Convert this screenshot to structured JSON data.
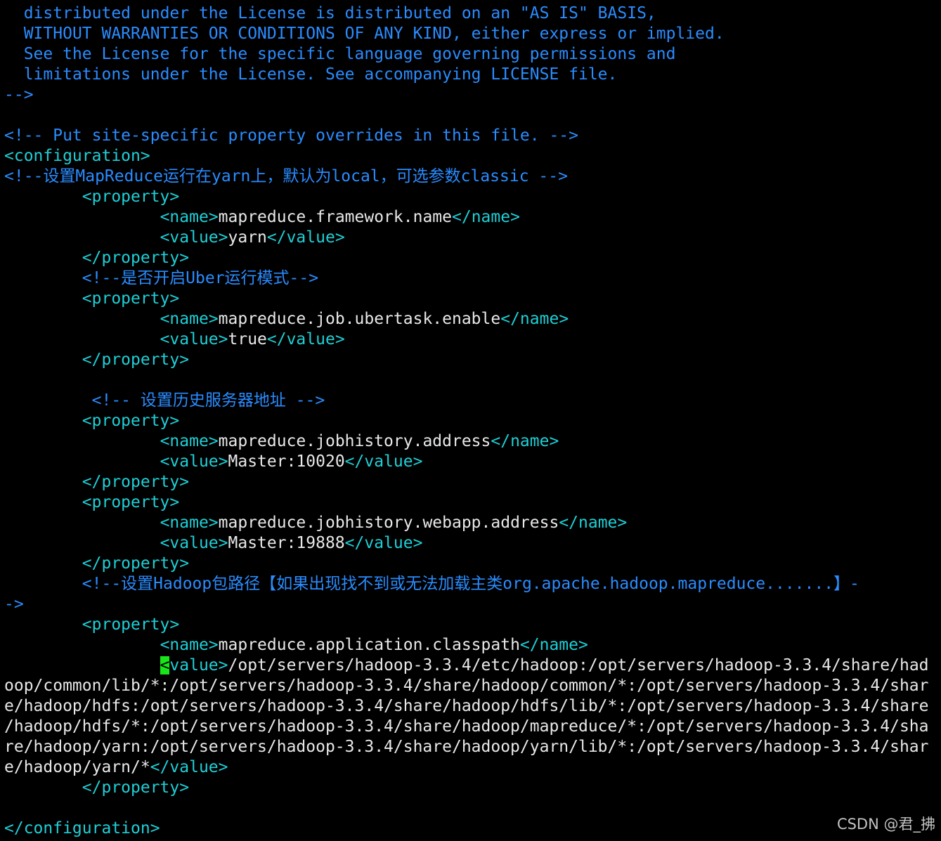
{
  "colors": {
    "background": "#000000",
    "comment": "#2a8cff",
    "tag": "#1ecfd6",
    "text": "#e8e8e8",
    "cursor": "#19e619"
  },
  "lines": [
    {
      "i": "  ",
      "s": [
        {
          "k": "c",
          "t": "distributed under the License is distributed on an \"AS IS\" BASIS,"
        }
      ]
    },
    {
      "i": "  ",
      "s": [
        {
          "k": "c",
          "t": "WITHOUT WARRANTIES OR CONDITIONS OF ANY KIND, either express or implied."
        }
      ]
    },
    {
      "i": "  ",
      "s": [
        {
          "k": "c",
          "t": "See the License for the specific language governing permissions and"
        }
      ]
    },
    {
      "i": "  ",
      "s": [
        {
          "k": "c",
          "t": "limitations under the License. See accompanying LICENSE file."
        }
      ]
    },
    {
      "i": "",
      "s": [
        {
          "k": "c",
          "t": "-->"
        }
      ]
    },
    {
      "i": "",
      "s": []
    },
    {
      "i": "",
      "s": [
        {
          "k": "c",
          "t": "<!-- Put site-specific property overrides in this file. -->"
        }
      ]
    },
    {
      "i": "",
      "s": [
        {
          "k": "t",
          "t": "<configuration>"
        }
      ]
    },
    {
      "i": "",
      "s": [
        {
          "k": "c",
          "t": "<!--设置MapReduce运行在yarn上，默认为local，可选参数classic -->"
        }
      ]
    },
    {
      "i": "        ",
      "s": [
        {
          "k": "t",
          "t": "<property>"
        }
      ]
    },
    {
      "i": "                ",
      "s": [
        {
          "k": "t",
          "t": "<name>"
        },
        {
          "k": "v",
          "t": "mapreduce.framework.name"
        },
        {
          "k": "t",
          "t": "</name>"
        }
      ]
    },
    {
      "i": "                ",
      "s": [
        {
          "k": "t",
          "t": "<value>"
        },
        {
          "k": "v",
          "t": "yarn"
        },
        {
          "k": "t",
          "t": "</value>"
        }
      ]
    },
    {
      "i": "        ",
      "s": [
        {
          "k": "t",
          "t": "</property>"
        }
      ]
    },
    {
      "i": "        ",
      "s": [
        {
          "k": "c",
          "t": "<!--是否开启Uber运行模式-->"
        }
      ]
    },
    {
      "i": "        ",
      "s": [
        {
          "k": "t",
          "t": "<property>"
        }
      ]
    },
    {
      "i": "                ",
      "s": [
        {
          "k": "t",
          "t": "<name>"
        },
        {
          "k": "v",
          "t": "mapreduce.job.ubertask.enable"
        },
        {
          "k": "t",
          "t": "</name>"
        }
      ]
    },
    {
      "i": "                ",
      "s": [
        {
          "k": "t",
          "t": "<value>"
        },
        {
          "k": "v",
          "t": "true"
        },
        {
          "k": "t",
          "t": "</value>"
        }
      ]
    },
    {
      "i": "        ",
      "s": [
        {
          "k": "t",
          "t": "</property>"
        }
      ]
    },
    {
      "i": "",
      "s": []
    },
    {
      "i": "         ",
      "s": [
        {
          "k": "c",
          "t": "<!-- 设置历史服务器地址 -->"
        }
      ]
    },
    {
      "i": "        ",
      "s": [
        {
          "k": "t",
          "t": "<property>"
        }
      ]
    },
    {
      "i": "                ",
      "s": [
        {
          "k": "t",
          "t": "<name>"
        },
        {
          "k": "v",
          "t": "mapreduce.jobhistory.address"
        },
        {
          "k": "t",
          "t": "</name>"
        }
      ]
    },
    {
      "i": "                ",
      "s": [
        {
          "k": "t",
          "t": "<value>"
        },
        {
          "k": "v",
          "t": "Master:10020"
        },
        {
          "k": "t",
          "t": "</value>"
        }
      ]
    },
    {
      "i": "        ",
      "s": [
        {
          "k": "t",
          "t": "</property>"
        }
      ]
    },
    {
      "i": "        ",
      "s": [
        {
          "k": "t",
          "t": "<property>"
        }
      ]
    },
    {
      "i": "                ",
      "s": [
        {
          "k": "t",
          "t": "<name>"
        },
        {
          "k": "v",
          "t": "mapreduce.jobhistory.webapp.address"
        },
        {
          "k": "t",
          "t": "</name>"
        }
      ]
    },
    {
      "i": "                ",
      "s": [
        {
          "k": "t",
          "t": "<value>"
        },
        {
          "k": "v",
          "t": "Master:19888"
        },
        {
          "k": "t",
          "t": "</value>"
        }
      ]
    },
    {
      "i": "        ",
      "s": [
        {
          "k": "t",
          "t": "</property>"
        }
      ]
    },
    {
      "i": "        ",
      "s": [
        {
          "k": "c",
          "t": "<!--设置Hadoop包路径【如果出现找不到或无法加载主类org.apache.hadoop.mapreduce.......】-"
        }
      ]
    },
    {
      "i": "",
      "s": [
        {
          "k": "c",
          "t": "->"
        }
      ]
    },
    {
      "i": "        ",
      "s": [
        {
          "k": "t",
          "t": "<property>"
        }
      ]
    },
    {
      "i": "                ",
      "s": [
        {
          "k": "t",
          "t": "<name>"
        },
        {
          "k": "v",
          "t": "mapreduce.application.classpath"
        },
        {
          "k": "t",
          "t": "</name>"
        }
      ]
    },
    {
      "i": "                ",
      "s": [
        {
          "k": "cursor",
          "t": "<"
        },
        {
          "k": "t",
          "t": "value>"
        },
        {
          "k": "v",
          "t": "/opt/servers/hadoop-3.3.4/etc/hadoop:/opt/servers/hadoop-3.3.4/share/had"
        }
      ]
    },
    {
      "i": "",
      "s": [
        {
          "k": "v",
          "t": "oop/common/lib/*:/opt/servers/hadoop-3.3.4/share/hadoop/common/*:/opt/servers/hadoop-3.3.4/shar"
        }
      ]
    },
    {
      "i": "",
      "s": [
        {
          "k": "v",
          "t": "e/hadoop/hdfs:/opt/servers/hadoop-3.3.4/share/hadoop/hdfs/lib/*:/opt/servers/hadoop-3.3.4/share"
        }
      ]
    },
    {
      "i": "",
      "s": [
        {
          "k": "v",
          "t": "/hadoop/hdfs/*:/opt/servers/hadoop-3.3.4/share/hadoop/mapreduce/*:/opt/servers/hadoop-3.3.4/sha"
        }
      ]
    },
    {
      "i": "",
      "s": [
        {
          "k": "v",
          "t": "re/hadoop/yarn:/opt/servers/hadoop-3.3.4/share/hadoop/yarn/lib/*:/opt/servers/hadoop-3.3.4/shar"
        }
      ]
    },
    {
      "i": "",
      "s": [
        {
          "k": "v",
          "t": "e/hadoop/yarn/*"
        },
        {
          "k": "t",
          "t": "</value>"
        }
      ]
    },
    {
      "i": "        ",
      "s": [
        {
          "k": "t",
          "t": "</property>"
        }
      ]
    },
    {
      "i": "",
      "s": []
    },
    {
      "i": "",
      "s": [
        {
          "k": "t",
          "t": "</configuration>"
        }
      ]
    }
  ],
  "watermark": "CSDN @君_拂"
}
